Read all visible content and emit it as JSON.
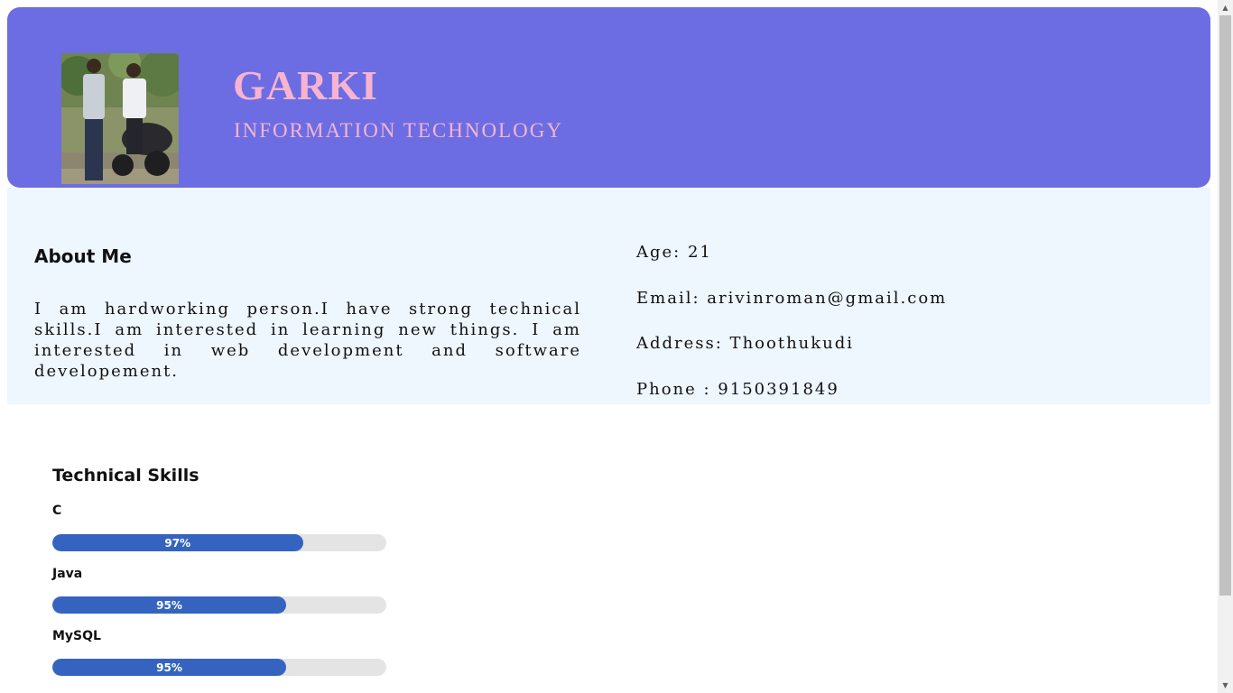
{
  "header": {
    "name": "GARKI",
    "department": "INFORMATION TECHNOLOGY",
    "photo_icon": "profile-photo"
  },
  "about": {
    "title": "About Me",
    "text": "I am hardworking person.I have strong technical skills.I am interested in learning new things. I am interested in web development and software developement."
  },
  "contact": {
    "age": "Age: 21",
    "email": "Email: arivinroman@gmail.com",
    "address": "Address: Thoothukudi",
    "phone": "Phone : 9150391849"
  },
  "skills": {
    "title": "Technical Skills",
    "items": [
      {
        "name": "C",
        "percent_label": "97%",
        "fill_fraction": 0.75
      },
      {
        "name": "Java",
        "percent_label": "95%",
        "fill_fraction": 0.7
      },
      {
        "name": "MySQL",
        "percent_label": "95%",
        "fill_fraction": 0.7
      }
    ]
  },
  "colors": {
    "header_bg": "#6c6de3",
    "accent_pink": "#f7b3cf",
    "info_bg": "#eef6fe",
    "bar_fill": "#3564c0",
    "bar_track": "#e4e4e4"
  }
}
